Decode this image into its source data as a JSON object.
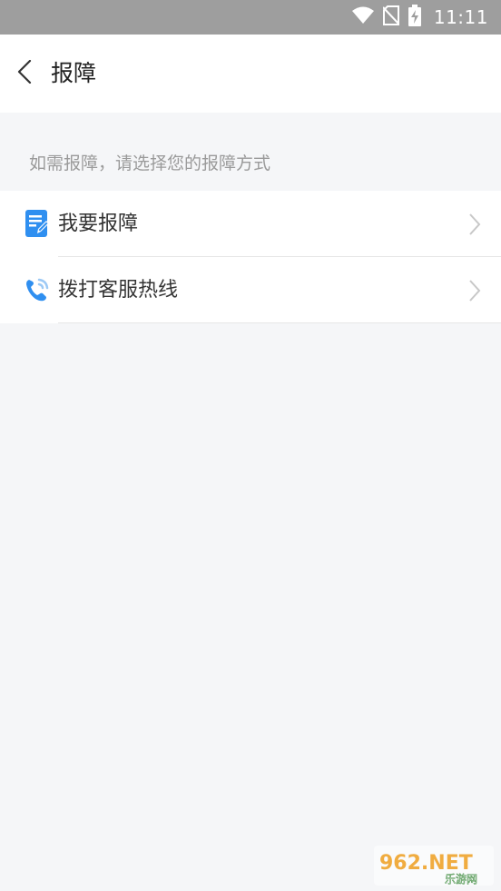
{
  "status_bar": {
    "time": "11:11",
    "icons": [
      "wifi-icon",
      "no-sim-icon",
      "battery-charging-icon"
    ]
  },
  "header": {
    "title": "报障",
    "back_icon": "chevron-left-icon"
  },
  "hint": "如需报障，请选择您的报障方式",
  "options": [
    {
      "label": "我要报障",
      "icon": "report-document-icon"
    },
    {
      "label": "拨打客服热线",
      "icon": "phone-call-icon"
    }
  ],
  "watermark": {
    "main": "962.NET",
    "sub": "乐游网"
  },
  "colors": {
    "accent": "#2f8ff0",
    "background": "#f5f6f8",
    "status_bar": "#9e9e9e",
    "hint_text": "#9a9a9a"
  }
}
